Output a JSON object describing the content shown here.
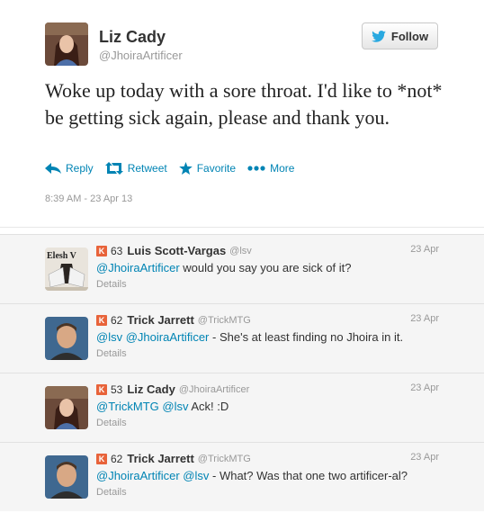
{
  "main_tweet": {
    "name": "Liz Cady",
    "handle": "@JhoiraArtificer",
    "follow_label": "Follow",
    "text": "Woke up today with a sore throat. I'd like to *not* be getting sick again, please and thank you.",
    "actions": {
      "reply": "Reply",
      "retweet": "Retweet",
      "favorite": "Favorite",
      "more": "More"
    },
    "timestamp": "8:39 AM - 23 Apr 13"
  },
  "replies": [
    {
      "score": "63",
      "name": "Luis Scott-Vargas",
      "handle": "@lsv",
      "date": "23 Apr",
      "mentions": [
        "@JhoiraArtificer"
      ],
      "text": "would you say you are sick of it?",
      "details": "Details",
      "avatar_caption": "Elesh V"
    },
    {
      "score": "62",
      "name": "Trick Jarrett",
      "handle": "@TrickMTG",
      "date": "23 Apr",
      "mentions": [
        "@lsv",
        "@JhoiraArtificer"
      ],
      "text": "- She's at least finding no Jhoira in it.",
      "details": "Details"
    },
    {
      "score": "53",
      "name": "Liz Cady",
      "handle": "@JhoiraArtificer",
      "date": "23 Apr",
      "mentions": [
        "@TrickMTG",
        "@lsv"
      ],
      "text": "Ack! :D",
      "details": "Details"
    },
    {
      "score": "62",
      "name": "Trick Jarrett",
      "handle": "@TrickMTG",
      "date": "23 Apr",
      "mentions": [
        "@JhoiraArtificer",
        "@lsv"
      ],
      "text": "- What? Was that one two artificer-al?",
      "details": "Details"
    }
  ],
  "colors": {
    "link": "#0084b4",
    "klout": "#e8633a",
    "reply_bg": "#f5f5f5"
  }
}
